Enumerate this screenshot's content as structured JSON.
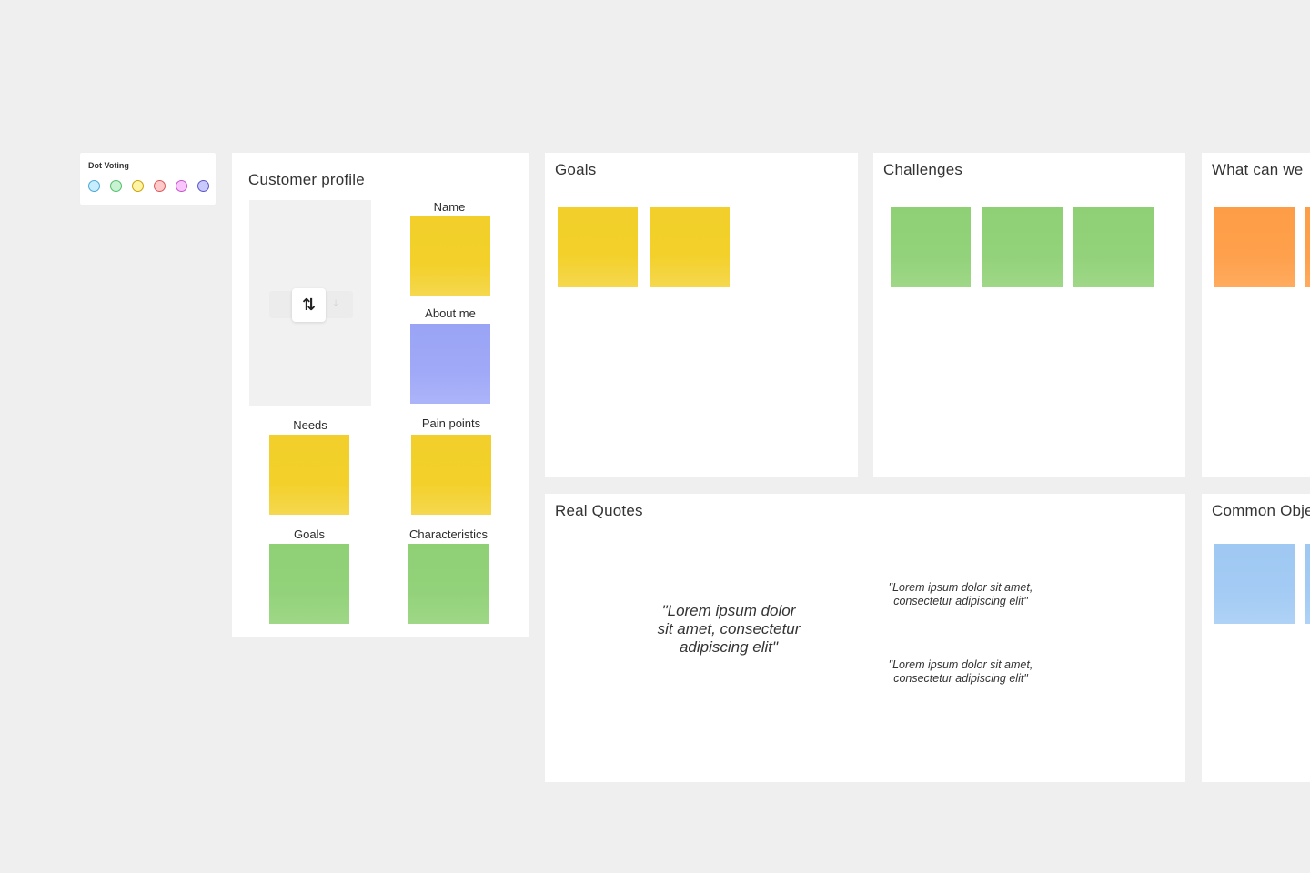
{
  "dot_voting": {
    "title": "Dot Voting",
    "dots": [
      {
        "name": "blue",
        "fill": "#c8edff",
        "border": "#4aa8d8"
      },
      {
        "name": "green",
        "fill": "#c9f2d2",
        "border": "#4fbf6b"
      },
      {
        "name": "yellow",
        "fill": "#fff3a6",
        "border": "#c9a400"
      },
      {
        "name": "red",
        "fill": "#ffc9c9",
        "border": "#d9575b"
      },
      {
        "name": "pink",
        "fill": "#f8c6fb",
        "border": "#c752cf"
      },
      {
        "name": "purple",
        "fill": "#c9c9fb",
        "border": "#5a55c9"
      }
    ]
  },
  "customer_profile": {
    "title": "Customer profile",
    "image_controls": {
      "swap_icon": "swap-arrows-icon",
      "swap_glyph": "⇅",
      "upload_icon": "upload-icon",
      "upload_glyph": "⤓"
    },
    "labels": {
      "name": "Name",
      "about_me": "About me",
      "needs": "Needs",
      "pain_points": "Pain points",
      "goals": "Goals",
      "characteristics": "Characteristics"
    }
  },
  "frames": {
    "goals": {
      "title": "Goals"
    },
    "challenges": {
      "title": "Challenges"
    },
    "what_can_we": {
      "title": "What can we"
    },
    "real_quotes": {
      "title": "Real Quotes",
      "quotes": [
        "\"Lorem ipsum dolor sit amet, consectetur adipiscing elit\"",
        "\"Lorem ipsum dolor sit amet, consectetur adipiscing elit\"",
        "\"Lorem ipsum dolor sit amet, consectetur adipiscing elit\""
      ]
    },
    "common_objections": {
      "title": "Common Obje"
    }
  },
  "colors": {
    "canvas_bg": "#efefef",
    "sticky_yellow": "#f3d02a",
    "sticky_green": "#92d27a",
    "sticky_purple": "#a0a9f7",
    "sticky_orange": "#fea04c",
    "sticky_blue": "#a3cbf4"
  }
}
